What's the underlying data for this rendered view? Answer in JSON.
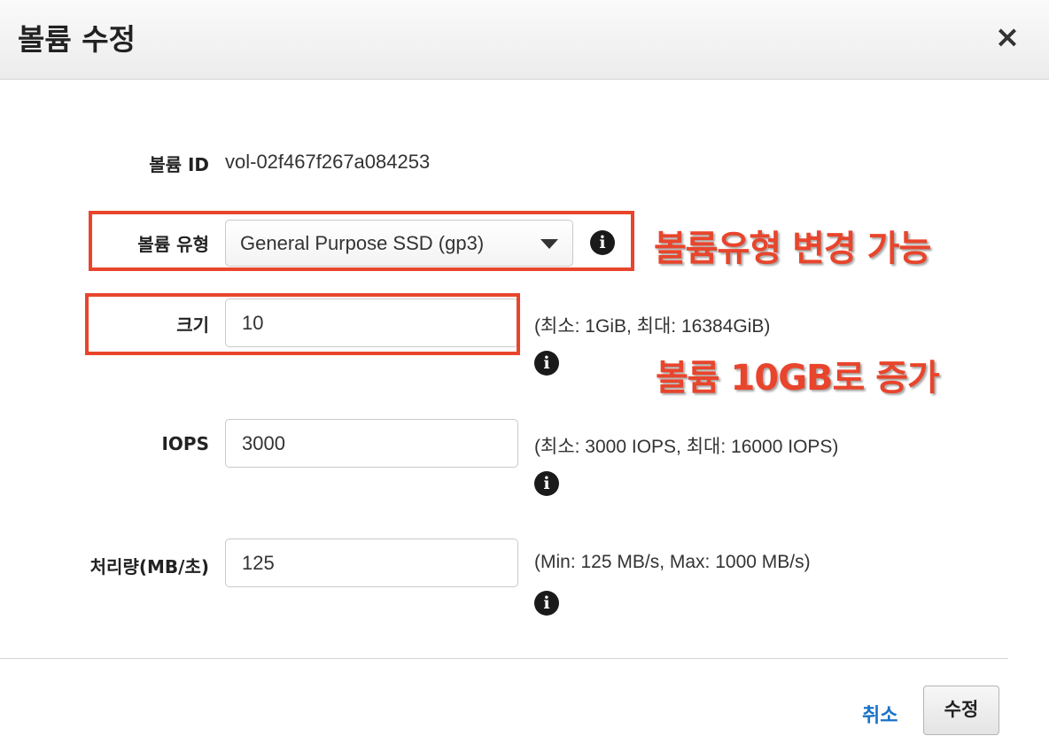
{
  "modal": {
    "title": "볼륨 수정",
    "close_icon": "close-icon",
    "close_label": "×"
  },
  "form": {
    "volume_id": {
      "label": "볼륨 ID",
      "value": "vol-02f467f267a084253"
    },
    "volume_type": {
      "label": "볼륨 유형",
      "selected": "General Purpose SSD (gp3)",
      "info_icon": "info-icon"
    },
    "size": {
      "label": "크기",
      "value": "10",
      "hint": "(최소: 1GiB, 최대: 16384GiB)",
      "info_icon": "info-icon"
    },
    "iops": {
      "label": "IOPS",
      "value": "3000",
      "hint": "(최소: 3000 IOPS, 최대: 16000 IOPS)",
      "info_icon": "info-icon"
    },
    "throughput": {
      "label": "처리량(MB/초)",
      "value": "125",
      "hint": "(Min: 125 MB/s, Max: 1000 MB/s)",
      "info_icon": "info-icon"
    },
    "info_glyph": "i"
  },
  "annotations": {
    "type_note": "볼륨유형 변경 가능",
    "size_note": "볼륨 10GB로 증가",
    "color": "#e8452c"
  },
  "footer": {
    "cancel_label": "취소",
    "submit_label": "수정"
  },
  "colors": {
    "link": "#1a73c7",
    "header_bg": "#f2f2f2"
  }
}
